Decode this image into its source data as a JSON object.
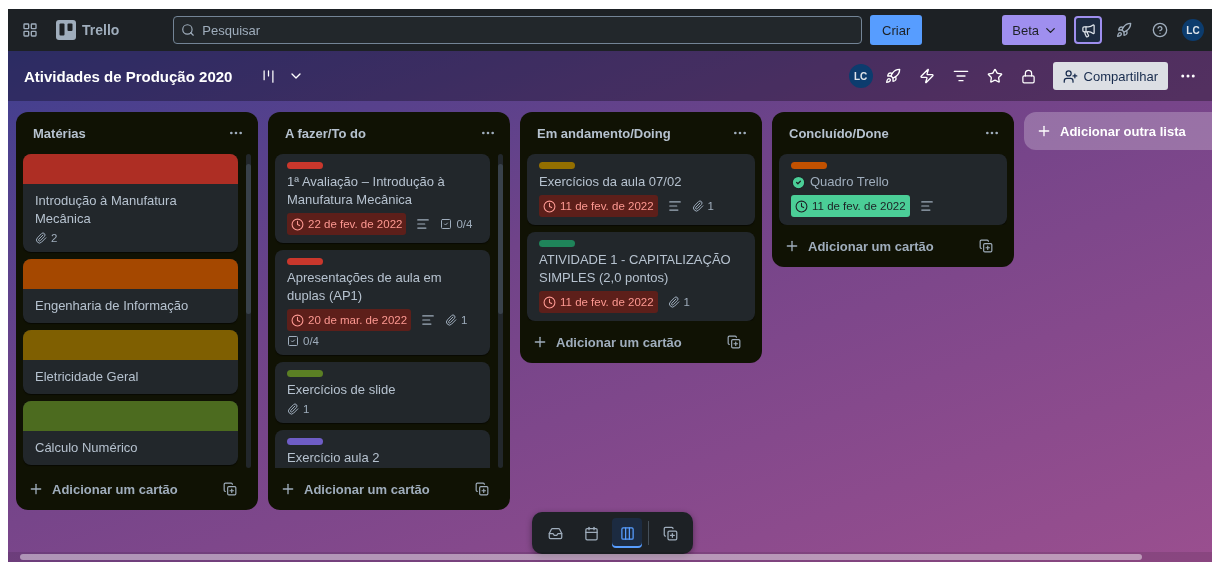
{
  "top_bar": {
    "product": "Trello",
    "search": {
      "placeholder": "Pesquisar"
    },
    "create_button": "Criar",
    "beta_button": "Beta",
    "avatar": "LC"
  },
  "board_header": {
    "title": "Atividades de Produção 2020",
    "avatar": "LC",
    "share_button": "Compartilhar"
  },
  "lists": [
    {
      "title": "Matérias",
      "clipped": true,
      "add_card": "Adicionar um cartão",
      "cards": [
        {
          "kind": "cover",
          "color": "#ae2e24",
          "title": "Introdução à Manufatura Mecânica",
          "attachments": "2"
        },
        {
          "kind": "cover",
          "color": "#a54800",
          "title": "Engenharia de Informação"
        },
        {
          "kind": "cover",
          "color": "#7f5f01",
          "title": "Eletricidade Geral"
        },
        {
          "kind": "cover",
          "color": "#4c6b1f",
          "title": "Cálculo Numérico"
        }
      ]
    },
    {
      "title": "A fazer/To do",
      "clipped": true,
      "add_card": "Adicionar um cartão",
      "cards": [
        {
          "kind": "label",
          "color": "#c9372c",
          "title": "1ª Avaliação – Introdução à Manufatura Mecânica",
          "due": {
            "text": "22 de fev. de 2022",
            "overdue": true
          },
          "description": true,
          "checklist": "0/4"
        },
        {
          "kind": "label",
          "color": "#c9372c",
          "title": "Apresentações de aula em duplas (AP1)",
          "due": {
            "text": "20 de mar. de 2022",
            "overdue": true
          },
          "description": true,
          "attachments": "1",
          "checklist": "0/4"
        },
        {
          "kind": "label",
          "color": "#5b7f24",
          "title": "Exercícios de slide",
          "attachments": "1"
        },
        {
          "kind": "label",
          "color": "#6e5dc6",
          "title": "Exercício aula 2"
        }
      ]
    },
    {
      "title": "Em andamento/Doing",
      "clipped": false,
      "add_card": "Adicionar um cartão",
      "cards": [
        {
          "kind": "label",
          "color": "#946f00",
          "title": "Exercícios da aula 07/02",
          "due": {
            "text": "11 de fev. de 2022",
            "overdue": true
          },
          "description": true,
          "attachments": "1"
        },
        {
          "kind": "label",
          "color": "#1f845a",
          "title": "ATIVIDADE 1 - CAPITALIZAÇÃO SIMPLES (2,0 pontos)",
          "due": {
            "text": "11 de fev. de 2022",
            "overdue": true
          },
          "attachments": "1"
        }
      ]
    },
    {
      "title": "Concluído/Done",
      "clipped": false,
      "add_card": "Adicionar um cartão",
      "cards": [
        {
          "kind": "label",
          "color": "#c25100",
          "title": "Quadro Trello",
          "done": true,
          "due": {
            "text": "11 de fev. de 2022",
            "overdue": false
          },
          "description": true
        }
      ]
    }
  ],
  "add_list": "Adicionar outra lista",
  "view_switcher": [
    {
      "kind": "inbox",
      "selected": false
    },
    {
      "kind": "calendar",
      "selected": false
    },
    {
      "kind": "board",
      "selected": true
    },
    {
      "kind": "switch",
      "selected": false
    }
  ]
}
